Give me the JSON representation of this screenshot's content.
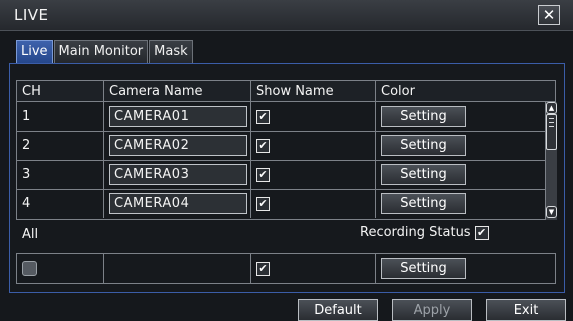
{
  "window": {
    "title": "LIVE",
    "close_glyph": "✕"
  },
  "tabs": [
    {
      "label": "Live",
      "active": true
    },
    {
      "label": "Main Monitor",
      "active": false
    },
    {
      "label": "Mask",
      "active": false
    }
  ],
  "table": {
    "headers": [
      "CH",
      "Camera Name",
      "Show Name",
      "Color"
    ],
    "rows": [
      {
        "ch": "1",
        "name": "CAMERA01",
        "show_name": true,
        "color_btn": "Setting"
      },
      {
        "ch": "2",
        "name": "CAMERA02",
        "show_name": true,
        "color_btn": "Setting"
      },
      {
        "ch": "3",
        "name": "CAMERA03",
        "show_name": true,
        "color_btn": "Setting"
      },
      {
        "ch": "4",
        "name": "CAMERA04",
        "show_name": true,
        "color_btn": "Setting"
      }
    ]
  },
  "all_section": {
    "label": "All",
    "recording_status_label": "Recording Status",
    "recording_status_checked": true,
    "all_checked": false,
    "show_name_checked": true,
    "color_btn": "Setting"
  },
  "footer": {
    "default_label": "Default",
    "apply_label": "Apply",
    "exit_label": "Exit"
  },
  "colors": {
    "accent": "#3b5da8",
    "active_tab": "#2f54a0"
  },
  "icons": {
    "check_glyph": "✔",
    "scroll_up_glyph": "▲",
    "scroll_down_glyph": "▼"
  }
}
